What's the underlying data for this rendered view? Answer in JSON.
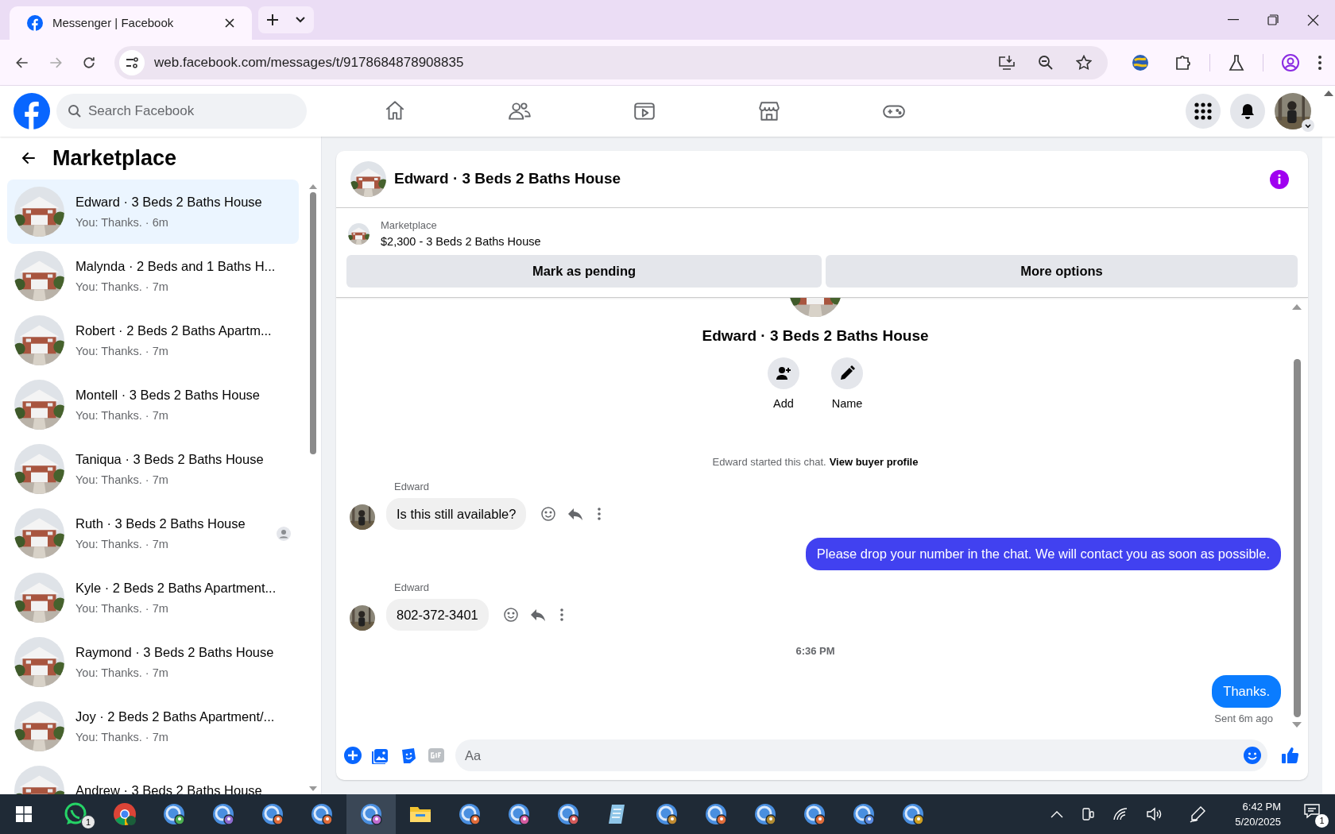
{
  "browser": {
    "tab_title": "Messenger | Facebook",
    "url": "web.facebook.com/messages/t/9178684878908835"
  },
  "facebook": {
    "search_placeholder": "Search Facebook"
  },
  "sidebar": {
    "title": "Marketplace",
    "conversations": [
      {
        "name": "Edward · 3 Beds 2 Baths House",
        "preview": "You: Thanks. · 6m",
        "selected": true,
        "seen": false
      },
      {
        "name": "Malynda · 2 Beds and 1 Baths H...",
        "preview": "You: Thanks. · 7m",
        "selected": false,
        "seen": false
      },
      {
        "name": "Robert · 2 Beds 2 Baths Apartm...",
        "preview": "You: Thanks. · 7m",
        "selected": false,
        "seen": false
      },
      {
        "name": "Montell · 3 Beds 2 Baths House",
        "preview": "You: Thanks. · 7m",
        "selected": false,
        "seen": false
      },
      {
        "name": "Taniqua · 3 Beds 2 Baths House",
        "preview": "You: Thanks. · 7m",
        "selected": false,
        "seen": false
      },
      {
        "name": "Ruth · 3 Beds 2 Baths House",
        "preview": "You: Thanks. · 7m",
        "selected": false,
        "seen": true
      },
      {
        "name": "Kyle · 2 Beds 2 Baths Apartment...",
        "preview": "You: Thanks. · 7m",
        "selected": false,
        "seen": false
      },
      {
        "name": "Raymond · 3 Beds 2 Baths House",
        "preview": "You: Thanks. · 7m",
        "selected": false,
        "seen": false
      },
      {
        "name": "Joy · 2 Beds 2 Baths Apartment/...",
        "preview": "You: Thanks. · 7m",
        "selected": false,
        "seen": false
      },
      {
        "name": "Andrew · 3 Beds 2 Baths House",
        "selected": false,
        "seen": false
      }
    ]
  },
  "chat": {
    "title": "Edward · 3 Beds 2 Baths House",
    "listing": {
      "label": "Marketplace",
      "text": "$2,300 - 3 Beds 2 Baths House"
    },
    "actions": [
      "Mark as pending",
      "More options"
    ],
    "profile": {
      "name": "Edward · 3 Beds 2 Baths House",
      "buttons": [
        {
          "kind": "add",
          "label": "Add"
        },
        {
          "kind": "name",
          "label": "Name"
        }
      ]
    },
    "notice": {
      "text": "Edward started this chat.",
      "link": "View buyer profile"
    },
    "messages": [
      {
        "kind": "incoming",
        "sender": "Edward",
        "text": "Is this still available?"
      },
      {
        "kind": "outgoing",
        "text": "Please drop your number in the chat. We will contact you as soon as possible.",
        "color": "#4141f0"
      },
      {
        "kind": "incoming",
        "sender": "Edward",
        "text": "802-372-3401"
      },
      {
        "kind": "timestamp",
        "text": "6:36 PM"
      },
      {
        "kind": "outgoing",
        "text": "Thanks.",
        "color": "#0a7cff",
        "status": "Sent 6m ago"
      }
    ],
    "composer": {
      "placeholder": "Aa"
    }
  },
  "taskbar": {
    "whatsapp_badge": "1",
    "notification_badge": "1",
    "time": "6:42 PM",
    "date": "5/20/2025"
  }
}
